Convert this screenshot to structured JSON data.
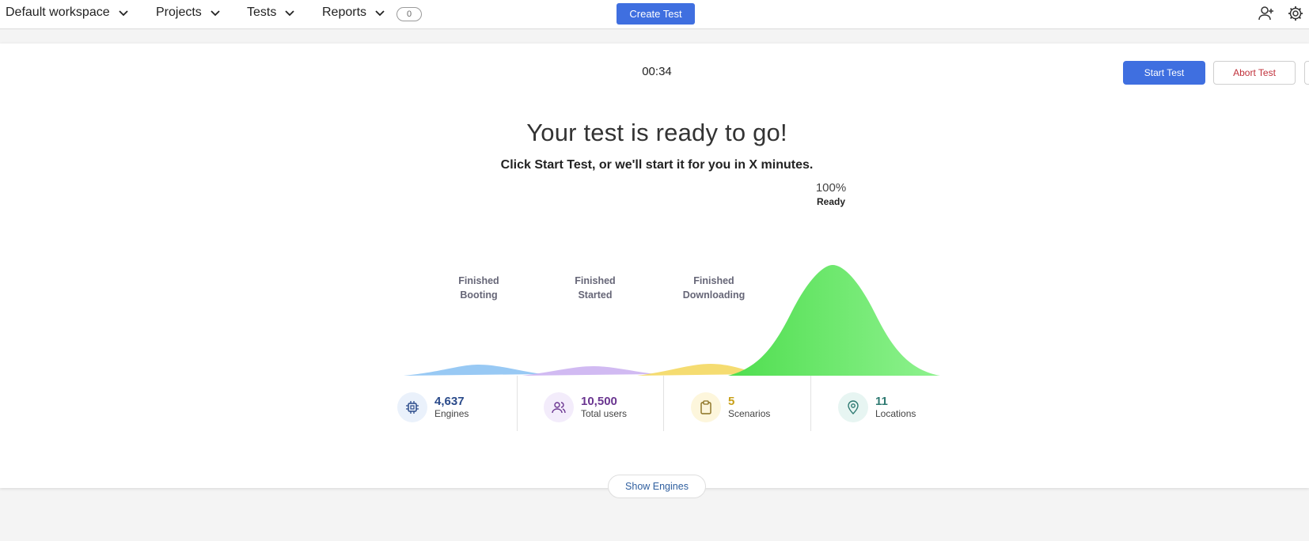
{
  "nav": {
    "workspace": "Default workspace",
    "projects": "Projects",
    "tests": "Tests",
    "reports": "Reports",
    "reports_count": "0",
    "create_test": "Create Test",
    "icons": [
      "add-user-icon",
      "gear-icon"
    ]
  },
  "run": {
    "timer": "00:34",
    "start_test": "Start Test",
    "abort_test": "Abort Test",
    "headline": "Your test is ready to go!",
    "subline": "Click Start Test, or we'll start it for you in X minutes.",
    "progress_pct": "100%",
    "progress_state": "Ready",
    "stages": [
      {
        "label": "Finished\nBooting",
        "color": "#7ab8f0"
      },
      {
        "label": "Finished\nStarted",
        "color": "#c4a8ee"
      },
      {
        "label": "Finished\nDownloading",
        "color": "#f2d35a"
      },
      {
        "label": "Ready",
        "color": "#5ee35e"
      }
    ]
  },
  "stats": [
    {
      "value": "4,637",
      "label": "Engines",
      "color": "#2a4a8a",
      "bg": "#eaf1fb",
      "icon": "cpu-icon"
    },
    {
      "value": "10,500",
      "label": "Total users",
      "color": "#6a3590",
      "bg": "#f3ecfb",
      "icon": "users-icon"
    },
    {
      "value": "5",
      "label": "Scenarios",
      "color": "#c8a01a",
      "bg": "#fdf6dc",
      "icon": "clipboard-icon"
    },
    {
      "value": "11",
      "label": "Locations",
      "color": "#2f7a72",
      "bg": "#e7f5f2",
      "icon": "location-pin-icon"
    }
  ],
  "show_engines": "Show Engines"
}
